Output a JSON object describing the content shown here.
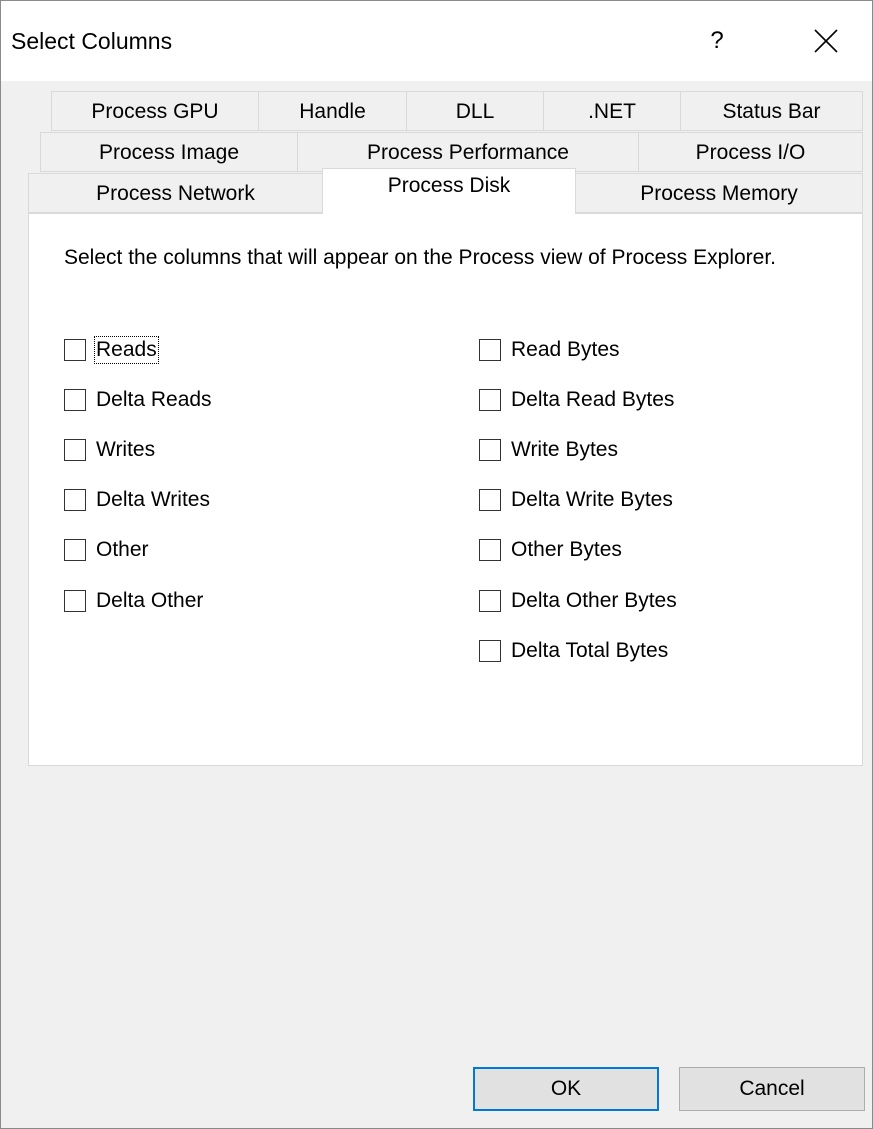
{
  "dialog": {
    "title": "Select Columns",
    "help": "?"
  },
  "tabs": {
    "row1": [
      "Process GPU",
      "Handle",
      "DLL",
      ".NET",
      "Status Bar"
    ],
    "row2": [
      "Process Image",
      "Process Performance",
      "Process I/O"
    ],
    "row3": [
      "Process Network",
      "Process Disk",
      "Process Memory"
    ],
    "active": "Process Disk"
  },
  "panel": {
    "description": "Select the columns that will appear on the Process view of Process Explorer.",
    "left_options": [
      {
        "label": "Reads",
        "checked": false
      },
      {
        "label": "Delta Reads",
        "checked": false
      },
      {
        "label": "Writes",
        "checked": false
      },
      {
        "label": "Delta Writes",
        "checked": false
      },
      {
        "label": "Other",
        "checked": false
      },
      {
        "label": "Delta Other",
        "checked": false
      }
    ],
    "right_options": [
      {
        "label": "Read Bytes",
        "checked": false
      },
      {
        "label": "Delta Read Bytes",
        "checked": false
      },
      {
        "label": "Write Bytes",
        "checked": false
      },
      {
        "label": "Delta Write Bytes",
        "checked": false
      },
      {
        "label": "Other Bytes",
        "checked": false
      },
      {
        "label": "Delta Other Bytes",
        "checked": false
      },
      {
        "label": "Delta Total Bytes",
        "checked": false
      }
    ]
  },
  "buttons": {
    "ok": "OK",
    "cancel": "Cancel"
  },
  "colors": {
    "accent": "#0078d7",
    "dialog_bg": "#f0f0f0",
    "panel_bg": "#ffffff"
  }
}
